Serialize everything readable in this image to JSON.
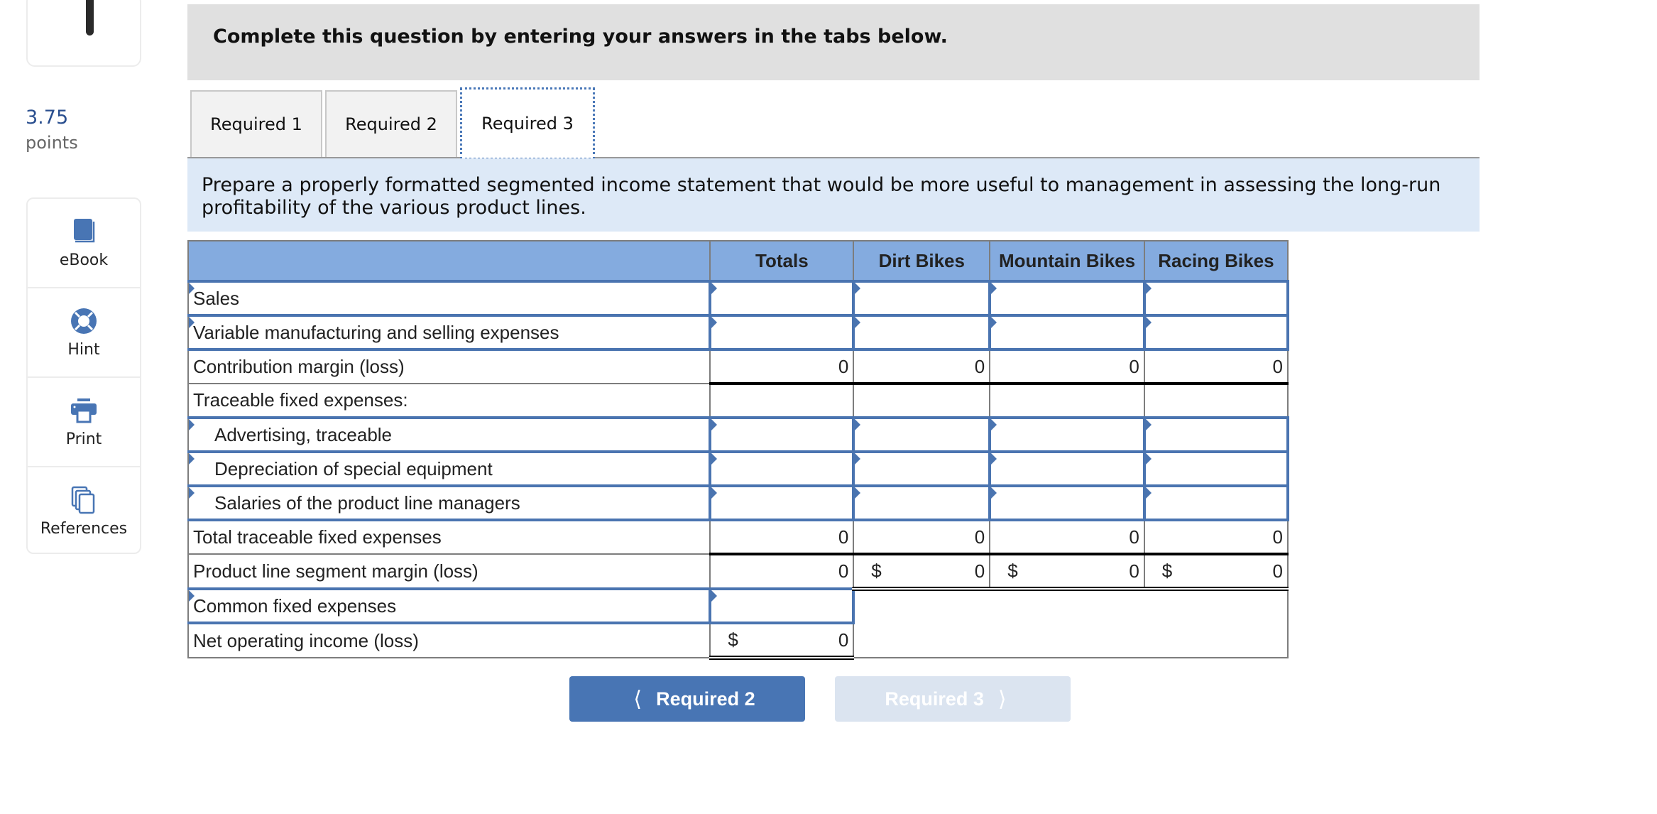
{
  "sidebar": {
    "points_value": "3.75",
    "points_label": "points",
    "tools": [
      {
        "label": "eBook",
        "icon": "book-icon"
      },
      {
        "label": "Hint",
        "icon": "lifebuoy-icon"
      },
      {
        "label": "Print",
        "icon": "printer-icon"
      },
      {
        "label": "References",
        "icon": "copy-icon"
      }
    ]
  },
  "header": {
    "text": "Complete this question by entering your answers in the tabs below."
  },
  "tabs": [
    {
      "label": "Required 1",
      "active": false
    },
    {
      "label": "Required 2",
      "active": false
    },
    {
      "label": "Required 3",
      "active": true
    }
  ],
  "instruction": "Prepare a properly formatted segmented income statement that would be more useful to management in assessing the long-run profitability of the various product lines.",
  "table": {
    "columns": [
      "",
      "Totals",
      "Dirt Bikes",
      "Mountain Bikes",
      "Racing Bikes"
    ],
    "rows": [
      {
        "label": "Sales",
        "values": [
          "",
          "",
          "",
          ""
        ]
      },
      {
        "label": "Variable manufacturing and selling expenses",
        "values": [
          "",
          "",
          "",
          ""
        ]
      },
      {
        "label": "Contribution margin (loss)",
        "values": [
          "0",
          "0",
          "0",
          "0"
        ]
      },
      {
        "label": "Traceable fixed expenses:",
        "values": [
          "",
          "",
          "",
          ""
        ]
      },
      {
        "label": "Advertising, traceable",
        "values": [
          "",
          "",
          "",
          ""
        ]
      },
      {
        "label": "Depreciation of special equipment",
        "values": [
          "",
          "",
          "",
          ""
        ]
      },
      {
        "label": "Salaries of the product line managers",
        "values": [
          "",
          "",
          "",
          ""
        ]
      },
      {
        "label": "Total traceable fixed expenses",
        "values": [
          "0",
          "0",
          "0",
          "0"
        ]
      },
      {
        "label": "Product line segment margin (loss)",
        "values": [
          "0",
          "0",
          "0",
          "0"
        ],
        "currency": "$"
      },
      {
        "label": "Common fixed expenses",
        "values": [
          ""
        ]
      },
      {
        "label": "Net operating income (loss)",
        "values": [
          "0"
        ],
        "currency": "$"
      }
    ]
  },
  "nav": {
    "prev_label": "Required 2",
    "next_label": "Required 3"
  }
}
